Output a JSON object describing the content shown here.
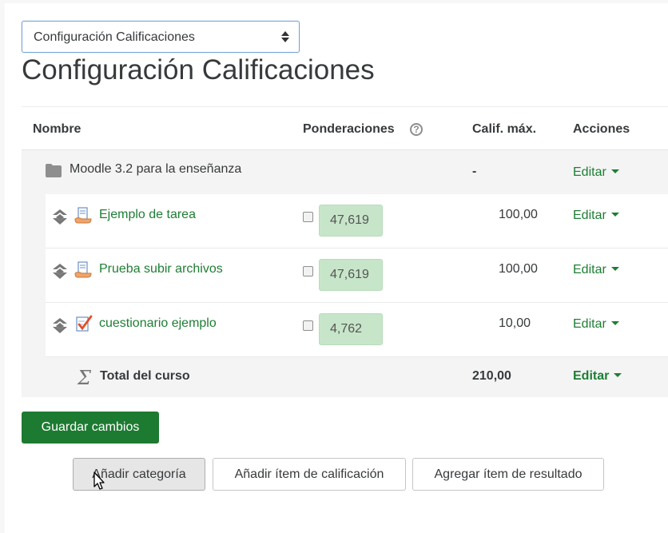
{
  "select": {
    "value": "Configuración Calificaciones"
  },
  "page_title": "Configuración Calificaciones",
  "table": {
    "headers": {
      "name": "Nombre",
      "weights": "Ponderaciones",
      "max_grade": "Calif. máx.",
      "actions": "Acciones"
    },
    "category": {
      "name": "Moodle 3.2 para la enseñanza",
      "max_grade": "-",
      "action": "Editar"
    },
    "items": [
      {
        "name": "Ejemplo de tarea",
        "weight": "47,619",
        "max_grade": "100,00",
        "action": "Editar",
        "icon": "assignment-icon"
      },
      {
        "name": "Prueba subir archivos",
        "weight": "47,619",
        "max_grade": "100,00",
        "action": "Editar",
        "icon": "assignment-icon"
      },
      {
        "name": "cuestionario ejemplo",
        "weight": "4,762",
        "max_grade": "10,00",
        "action": "Editar",
        "icon": "quiz-icon"
      }
    ],
    "total": {
      "name": "Total del curso",
      "max_grade": "210,00",
      "action": "Editar"
    }
  },
  "buttons": {
    "save": "Guardar cambios",
    "add_category": "Añadir categoría",
    "add_grade_item": "Añadir ítem de calificación",
    "add_outcome_item": "Agregar ítem de resultado"
  },
  "colors": {
    "primary": "#1d7a31",
    "link": "#1e7e34",
    "weight_box": "#c7e5c9"
  }
}
